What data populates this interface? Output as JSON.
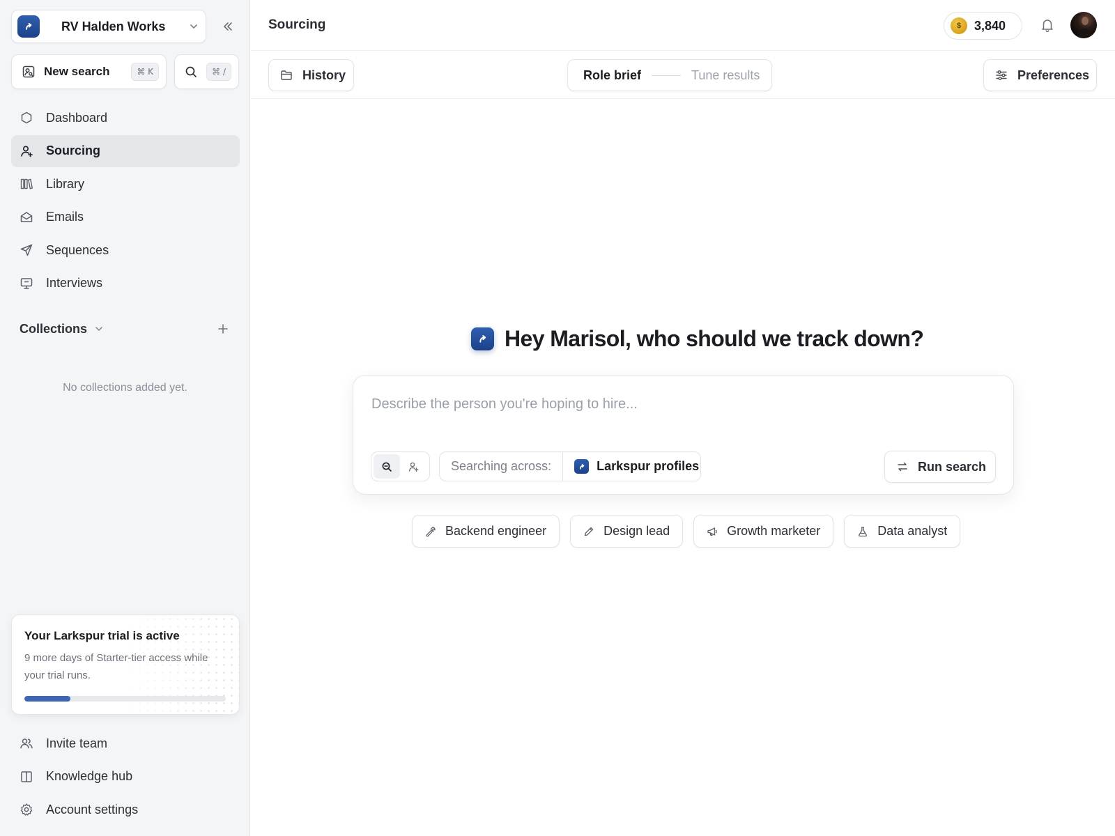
{
  "workspace": {
    "name": "RV Halden Works"
  },
  "sidebar": {
    "new_search": {
      "label": "New search",
      "shortcut": "⌘ K"
    },
    "search": {
      "shortcut": "⌘ /"
    },
    "nav": [
      {
        "label": "Dashboard",
        "icon": "hexagon-icon"
      },
      {
        "label": "Sourcing",
        "icon": "user-icon",
        "active": true
      },
      {
        "label": "Library",
        "icon": "library-icon"
      },
      {
        "label": "Emails",
        "icon": "mail-open-icon"
      },
      {
        "label": "Sequences",
        "icon": "send-icon"
      },
      {
        "label": "Interviews",
        "icon": "monitor-icon"
      }
    ],
    "collections": {
      "title": "Collections",
      "empty": "No collections added yet."
    },
    "trial": {
      "title": "Your Larkspur trial is active",
      "description": "9 more days of Starter-tier access while your trial runs.",
      "progress": 0.23
    },
    "bottom_nav": [
      {
        "label": "Invite team",
        "icon": "users-icon"
      },
      {
        "label": "Knowledge hub",
        "icon": "book-icon"
      },
      {
        "label": "Account settings",
        "icon": "gear-icon"
      }
    ]
  },
  "header": {
    "title": "Sourcing",
    "credits": "3,840",
    "coin_symbol": "$"
  },
  "toolbar": {
    "history": "History",
    "step_1": "Role brief",
    "step_2": "Tune results",
    "preferences": "Preferences"
  },
  "main": {
    "greeting": "Hey Marisol, who should we track down?",
    "prompt_placeholder": "Describe the person you're hoping to hire...",
    "prompt_value": "",
    "searching_label": "Searching across:",
    "source_name": "Larkspur profiles",
    "run_label": "Run search",
    "suggestions": [
      {
        "label": "Backend engineer",
        "icon": "wrench-icon"
      },
      {
        "label": "Design lead",
        "icon": "pencil-icon"
      },
      {
        "label": "Growth marketer",
        "icon": "megaphone-icon"
      },
      {
        "label": "Data analyst",
        "icon": "flask-icon"
      }
    ]
  },
  "colors": {
    "brand": "#2f5fb0",
    "sidebar_bg": "#f4f5f7",
    "active_nav": "#e4e6ea",
    "progress": "#3d67b6",
    "coin": "#d8a21d"
  }
}
